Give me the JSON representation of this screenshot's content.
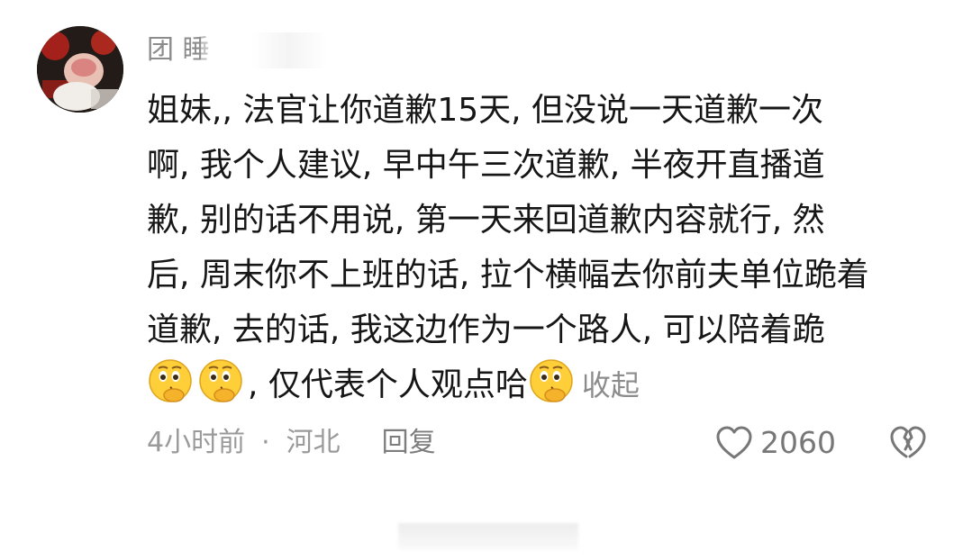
{
  "comment": {
    "username": "团 睡",
    "lines": [
      "姐妹,, 法官让你道歉15天, 但没说一天道歉一次",
      "啊, 我个人建议, 早中午三次道歉, 半夜开直播道",
      "歉, 别的话不用说, 第一天来回道歉内容就行, 然",
      "后, 周末你不上班的话, 拉个横幅去你前夫单位跪着",
      "道歉, 去的话, 我这边作为一个路人, 可以陪着跪"
    ],
    "last_line_text": ", 仅代表个人观点哈",
    "collapse_label": "收起",
    "emoji_name": "thinking-face-icon",
    "time": "4小时前",
    "separator": "·",
    "location": "河北",
    "reply_label": "回复",
    "like_count": "2060"
  },
  "colors": {
    "text": "#161616",
    "muted": "#8c8c8c",
    "emoji_yellow": "#ffcf3a"
  }
}
